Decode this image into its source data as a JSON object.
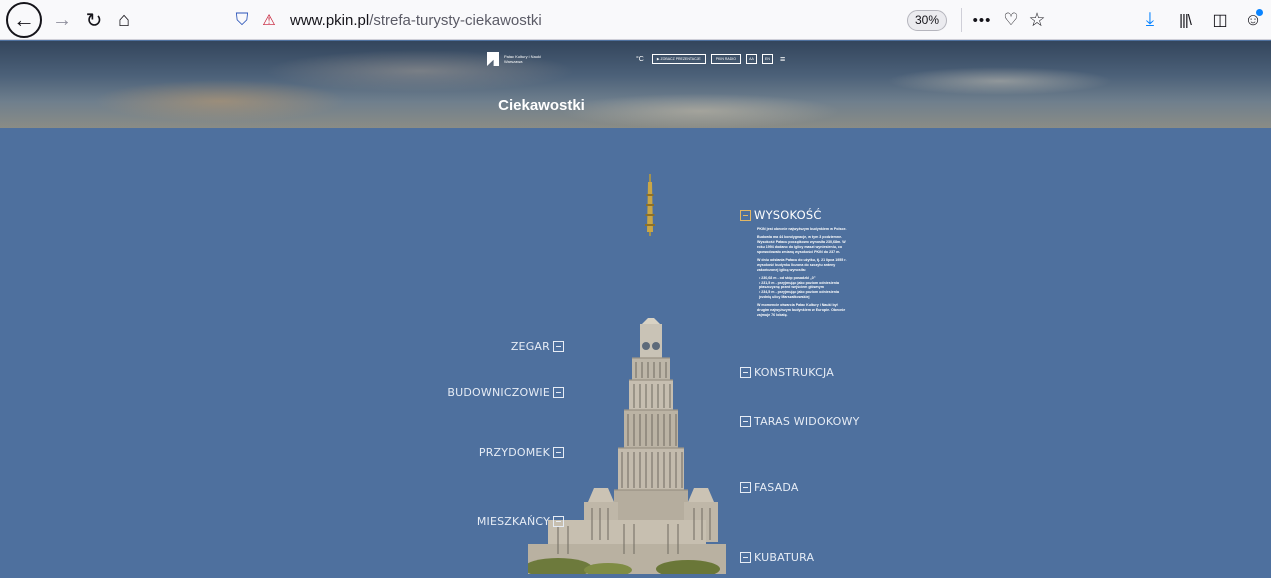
{
  "browser": {
    "back_icon": "back-arrow-icon",
    "forward_icon": "forward-arrow-icon",
    "reload_icon": "reload-icon",
    "home_icon": "home-icon",
    "url_host": "www.pkin.pl",
    "url_path": "/strefa-turysty-ciekawostki",
    "zoom": "30%",
    "icons": [
      "shield-icon",
      "insecure-lock-icon",
      "more-icon",
      "pocket-icon",
      "star-icon",
      "download-icon",
      "library-icon",
      "sidebar-icon",
      "account-icon"
    ]
  },
  "site": {
    "logo_line1": "Pałac Kultury i Nauki",
    "logo_line2": "Warszawa",
    "temperature_unit": "°C",
    "nav": {
      "presentation": "▶ ZOBACZ PREZENTACJE",
      "radio": "PKIN RADIO",
      "font_size": "AA",
      "language": "EN"
    },
    "page_title": "Ciekawostki"
  },
  "sections": {
    "left": [
      "ZEGAR",
      "BUDOWNICZOWIE",
      "PRZYDOMEK",
      "MIESZKAŃCY"
    ],
    "right": [
      "WYSOKOŚĆ",
      "KONSTRUKCJA",
      "TARAS WIDOKOWY",
      "FASADA",
      "KUBATURA"
    ],
    "active": "WYSOKOŚĆ"
  },
  "wysokosc_text": {
    "p1": "PKiN jest obecnie najwyższym budynkiem w Polsce.",
    "p2": "Budowla ma 44 kondygnacje, w tym 3 podziemne. Wysokość Pałacu początkowo wynosiła 230,68m. W roku 1994 dodano do iglicy maszt wyniesieniu, co spowodowało zmianę wysokości PKiN do 237 m.",
    "p3": "W dniu odsłania Pałacu do użytku, tj. 21 lipca 1955 r. wysokość budynku liczona do szczytu anteny zakończonej iglicą wynosiła:",
    "list": [
      "230,68 m - od stóp posadzki „0”",
      "231,5 m - przyjmując jako poziom odniesienia płaszczyznę przed wejściem głównym",
      "234,5 m - przyjmując jako poziom odniesienia jezdnię ulicy Marszałkowskiej"
    ],
    "p4": "W momencie otwarcia Pałac Kultury i Nauki był drugim najwyższym budynkiem w Europie. Obecnie zajmuje 76 lokatę."
  }
}
